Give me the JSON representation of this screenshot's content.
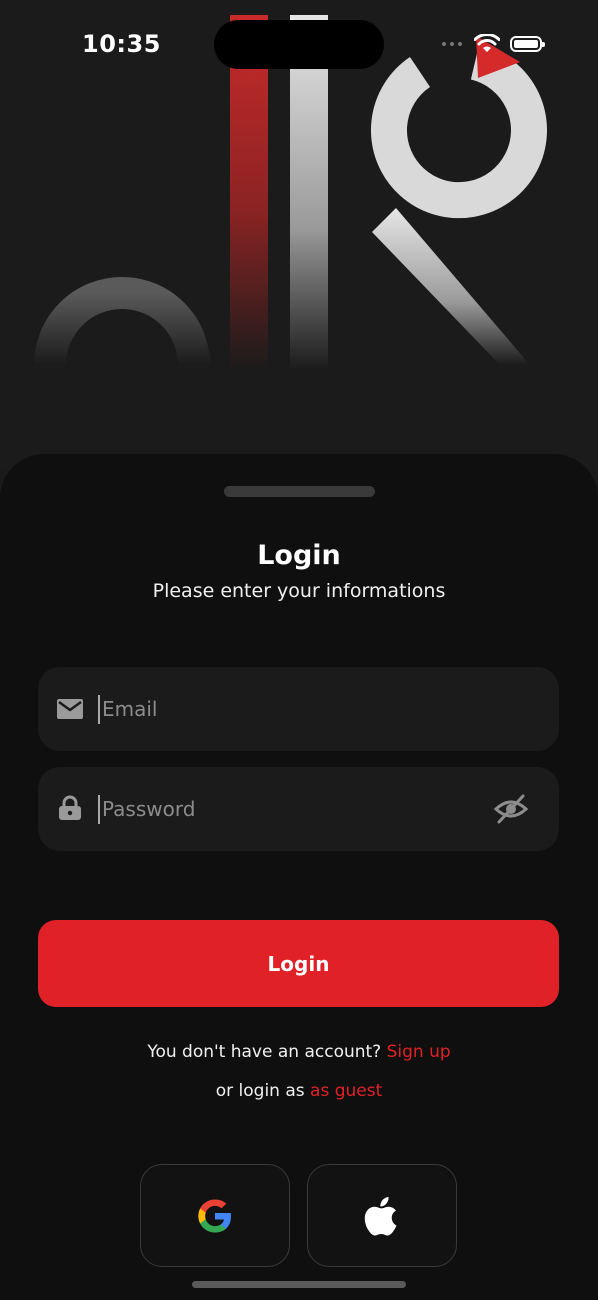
{
  "status_bar": {
    "time": "10:35"
  },
  "sheet": {
    "title": "Login",
    "subtitle": "Please enter your informations"
  },
  "form": {
    "email": {
      "placeholder": "Email",
      "value": "",
      "icon": "mail-icon"
    },
    "password": {
      "placeholder": "Password",
      "value": "",
      "icon": "lock-icon",
      "toggle_icon": "eye-off-icon"
    },
    "login_label": "Login"
  },
  "links": {
    "signup_prompt": "You don't have an account?",
    "signup_label": "Sign up",
    "guest_prompt": "or login as",
    "guest_label": "as guest"
  },
  "social": [
    {
      "name": "google",
      "icon": "google-icon"
    },
    {
      "name": "apple",
      "icon": "apple-icon"
    }
  ],
  "colors": {
    "accent": "#e02127",
    "background": "#0f0f0f",
    "field": "#1b1b1b"
  }
}
